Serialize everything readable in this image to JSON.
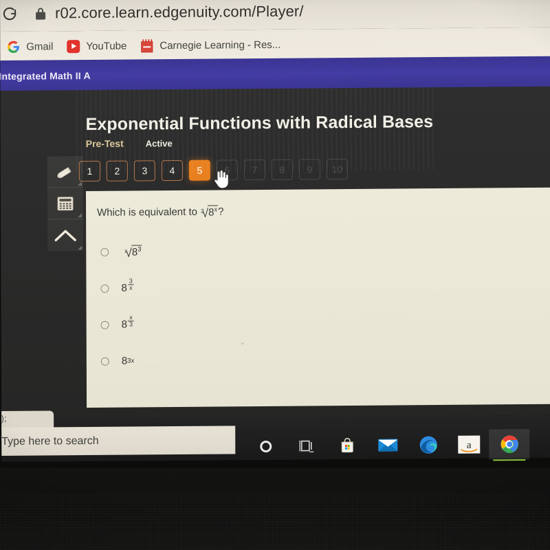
{
  "browser": {
    "reload_icon": "reload-icon",
    "lock_icon": "lock-icon",
    "url": "r02.core.learn.edgenuity.com/Player/",
    "bookmarks": [
      {
        "label": "Gmail",
        "icon": "google-icon"
      },
      {
        "label": "YouTube",
        "icon": "youtube-icon"
      },
      {
        "label": "Carnegie Learning - Res...",
        "icon": "carnegie-learning-icon"
      }
    ]
  },
  "course": {
    "title": "Integrated Math II A",
    "bar_color": "#3f399c"
  },
  "lesson": {
    "title": "Exponential Functions with Radical Bases",
    "phase": "Pre-Test",
    "phase_color": "#d9c89a",
    "state": "Active"
  },
  "tools": [
    {
      "name": "pencil-tool",
      "icon": "pencil-icon"
    },
    {
      "name": "calculator-tool",
      "icon": "calculator-icon"
    },
    {
      "name": "scroll-up-tool",
      "icon": "up-arrow-icon"
    }
  ],
  "question_nav": {
    "current": "5",
    "accent_color": "#e8801f",
    "items": [
      {
        "label": "1",
        "state": "done"
      },
      {
        "label": "2",
        "state": "done"
      },
      {
        "label": "3",
        "state": "done"
      },
      {
        "label": "4",
        "state": "done"
      },
      {
        "label": "5",
        "state": "current"
      },
      {
        "label": "6",
        "state": "locked"
      },
      {
        "label": "7",
        "state": "locked"
      },
      {
        "label": "8",
        "state": "locked"
      },
      {
        "label": "9",
        "state": "locked"
      },
      {
        "label": "10",
        "state": "locked"
      }
    ]
  },
  "question": {
    "prompt_prefix": "Which is equivalent to ",
    "prompt_suffix": "?",
    "prompt_math": {
      "radical_index": "3",
      "radicand_base": "8",
      "radicand_exponent": "x"
    },
    "options": [
      {
        "id": "a",
        "form": "radical",
        "radical_index": "x",
        "radicand_base": "8",
        "radicand_exponent": "3",
        "text": "x-th root of 8 cubed",
        "selected": false
      },
      {
        "id": "b",
        "form": "power-fraction",
        "base": "8",
        "exp_numerator": "3",
        "exp_denominator": "x",
        "text": "8 to the power 3 over x",
        "selected": false
      },
      {
        "id": "c",
        "form": "power-fraction",
        "base": "8",
        "exp_numerator": "x",
        "exp_denominator": "3",
        "text": "8 to the power x over 3",
        "selected": false
      },
      {
        "id": "d",
        "form": "power-simple",
        "base": "8",
        "exponent": "3x",
        "text": "8 to the power 3x",
        "selected": false
      }
    ]
  },
  "cursor": {
    "icon": "hand-pointer-cursor",
    "over": "question-nav-button-5"
  },
  "taskbar": {
    "search_placeholder": "Type here to search",
    "code_fragment": "D);",
    "items": [
      {
        "name": "cortana",
        "icon": "cortana-circle-icon",
        "active": false
      },
      {
        "name": "task-view",
        "icon": "task-view-icon",
        "active": false
      },
      {
        "name": "microsoft-store",
        "icon": "microsoft-store-icon",
        "active": false
      },
      {
        "name": "mail",
        "icon": "mail-icon",
        "active": false
      },
      {
        "name": "microsoft-edge",
        "icon": "edge-icon",
        "active": false
      },
      {
        "name": "amazon",
        "icon": "amazon-icon",
        "active": false
      },
      {
        "name": "google-chrome",
        "icon": "chrome-icon",
        "active": true
      }
    ]
  }
}
